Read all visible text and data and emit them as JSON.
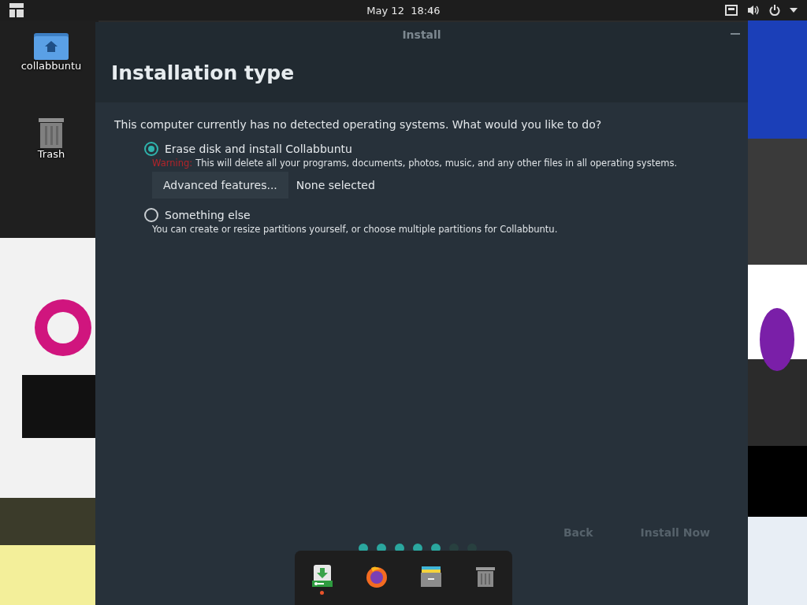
{
  "top_bar": {
    "clock": "May 12  18:46"
  },
  "desktop_icons": [
    {
      "label": "collabbuntu",
      "kind": "home"
    },
    {
      "label": "Trash",
      "kind": "trash"
    }
  ],
  "window": {
    "title": "Install",
    "heading": "Installation type",
    "question": "This computer currently has no detected operating systems. What would you like to do?",
    "options": [
      {
        "label": "Erase disk and install Collabbuntu",
        "selected": true,
        "warning": "Warning:",
        "description": "This will delete all your programs, documents, photos, music, and any other files in all operating systems.",
        "button": "Advanced features...",
        "status": "None selected"
      },
      {
        "label": "Something else",
        "selected": false,
        "description": "You can create or resize partitions yourself, or choose multiple partitions for Collabbuntu."
      }
    ],
    "buttons": [
      {
        "label": "Back",
        "disabled": true
      },
      {
        "label": "Install Now",
        "disabled": true
      }
    ],
    "progress": [
      {
        "done": true
      },
      {
        "done": true
      },
      {
        "done": true
      },
      {
        "done": true
      },
      {
        "done": true
      },
      {
        "done": false
      },
      {
        "done": false
      }
    ]
  },
  "dock": [
    {
      "kind": "installer",
      "running": true
    },
    {
      "kind": "firefox",
      "running": false
    },
    {
      "kind": "files",
      "running": false
    },
    {
      "kind": "trash",
      "running": false
    }
  ]
}
